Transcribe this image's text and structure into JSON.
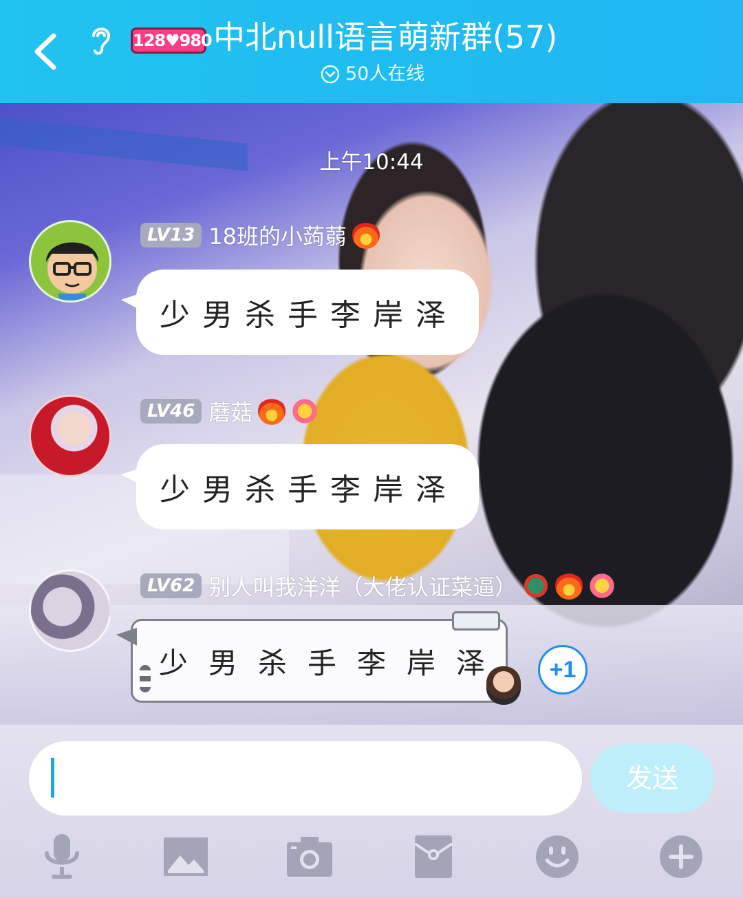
{
  "header": {
    "group_badge": "128♥980",
    "title": "中北null语言萌新群(57)",
    "online_status": "50人在线",
    "colors": {
      "bar": "#21c3ef",
      "text": "#ffffff"
    }
  },
  "chat": {
    "timestamp": "上午10:44",
    "messages": [
      {
        "level": "LV13",
        "sender": "18班的小蒟蒻",
        "badges": [
          "fire-emoji"
        ],
        "text": "少男杀手李岸泽"
      },
      {
        "level": "LV46",
        "sender": "蘑菇",
        "badges": [
          "fire-emoji",
          "laughing-flower-emoji"
        ],
        "text": "少男杀手李岸泽"
      },
      {
        "level": "LV62",
        "sender": "别人叫我洋洋（大佬认证菜逼）",
        "badges": [
          "dragon-emoji",
          "fire-emoji",
          "laughing-flower-emoji"
        ],
        "text": "少男杀手李岸泽"
      }
    ],
    "plus_one": "+1"
  },
  "input": {
    "value": "",
    "placeholder": "",
    "send_label": "发送",
    "colors": {
      "caret": "#18a8ea",
      "send_bg": "#bfeefb"
    }
  },
  "toolbar": {
    "icons": [
      "microphone-icon",
      "image-icon",
      "camera-icon",
      "red-packet-icon",
      "emoji-icon",
      "plus-icon"
    ]
  }
}
